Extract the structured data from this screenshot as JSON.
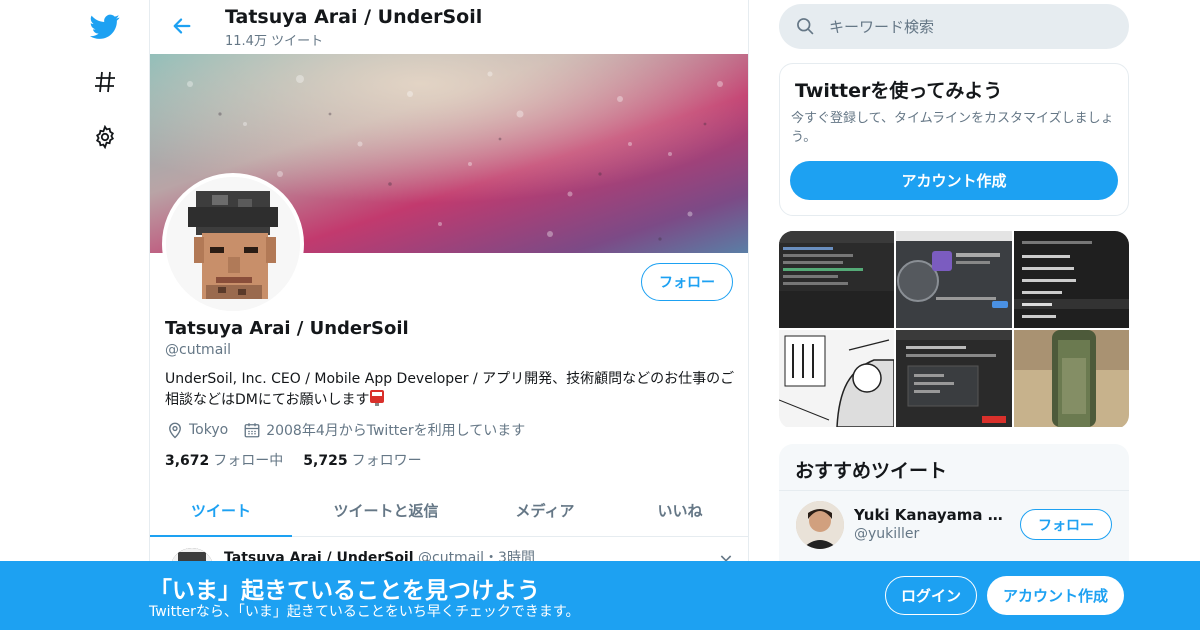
{
  "colors": {
    "accent": "#1da1f2",
    "text": "#14171a",
    "muted": "#657786",
    "border": "#e6ecf0"
  },
  "nav": {
    "icons": [
      "twitter-bird-icon",
      "hashtag-icon",
      "gear-icon"
    ]
  },
  "header": {
    "title": "Tatsuya Arai / UnderSoil",
    "tweet_count": "11.4万 ツイート"
  },
  "profile": {
    "name": "Tatsuya Arai / UnderSoil",
    "handle": "@cutmail",
    "bio": "UnderSoil, Inc. CEO / Mobile App Developer / アプリ開発、技術顧問などのお仕事のご相談などはDMにてお願いします",
    "location": "Tokyo",
    "joined": "2008年4月からTwitterを利用しています",
    "following_count": "3,672",
    "following_label": "フォロー中",
    "followers_count": "5,725",
    "followers_label": "フォロワー",
    "follow_label": "フォロー"
  },
  "tabs": [
    {
      "label": "ツイート",
      "active": true
    },
    {
      "label": "ツイートと返信",
      "active": false
    },
    {
      "label": "メディア",
      "active": false
    },
    {
      "label": "いいね",
      "active": false
    }
  ],
  "tweet": {
    "author": "Tatsuya Arai / UnderSoil",
    "handle": "@cutmail",
    "time": "・3時間"
  },
  "search": {
    "placeholder": "キーワード検索"
  },
  "signup_card": {
    "title": "Twitterを使ってみよう",
    "text": "今すぐ登録して、タイムラインをカスタマイズしましょう。",
    "button": "アカウント作成"
  },
  "recommended": {
    "title": "おすすめツイート",
    "user_name": "Yuki Kanayama 金山裕樹",
    "user_handle": "@yukiller",
    "follow_label": "フォロー"
  },
  "bottom_bar": {
    "title": "「いま」起きていることを見つけよう",
    "subtitle": "Twitterなら、「いま」起きていることをいち早くチェックできます。",
    "login": "ログイン",
    "signup": "アカウント作成"
  }
}
